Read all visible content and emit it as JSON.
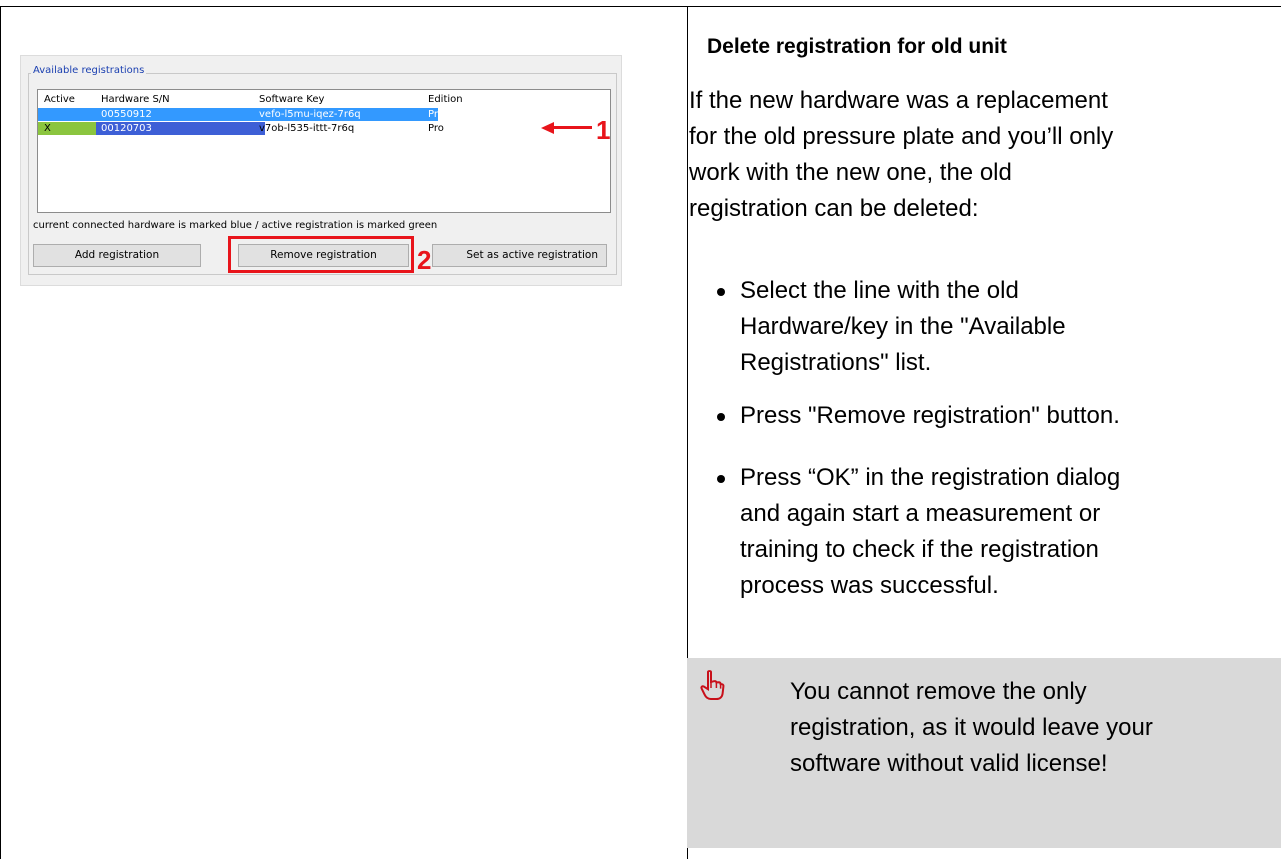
{
  "screenshot": {
    "group_title": "Available registrations",
    "columns": [
      "Active",
      "Hardware S/N",
      "Software Key",
      "Edition"
    ],
    "rows": [
      {
        "active": "",
        "hardware_sn": "00550912",
        "software_key": "vefo-l5mu-iqez-7r6q",
        "edition": "Pro"
      },
      {
        "active": "X",
        "hardware_sn": "00120703",
        "software_key": "v7ob-l535-ittt-7r6q",
        "edition": "Pro"
      }
    ],
    "hint": "current connected hardware is marked blue / active registration is marked green",
    "buttons": {
      "add": "Add registration",
      "remove": "Remove registration",
      "set_active": "Set as active registration"
    },
    "markers": {
      "one": "1",
      "two": "2"
    }
  },
  "article": {
    "heading": "Delete registration for old unit",
    "intro_lines": [
      "If the new hardware was a replacement",
      "for the old pressure plate and you’ll only",
      "work with the new one, the old",
      "registration can be deleted:"
    ],
    "bullets": [
      {
        "lines": [
          "Select the line with the old",
          "Hardware/key in the \"Available",
          "Registrations\" list."
        ]
      },
      {
        "lines": [
          "Press \"Remove registration\" button."
        ]
      },
      {
        "lines": [
          "Press “OK” in the registration dialog",
          "and again start a measurement or",
          "training to check if the registration",
          "process was successful."
        ]
      }
    ],
    "note": {
      "icon": "pointing-hand-icon",
      "lines": [
        "You cannot remove the only",
        "registration, as it would leave your",
        "software without valid license!"
      ]
    }
  },
  "colors": {
    "selection_blue": "#3399ff",
    "active_green": "#8bc53f",
    "connected_blue": "#3d5fd6",
    "annotation_red": "#e8141b",
    "note_background": "#d9d9d9"
  }
}
